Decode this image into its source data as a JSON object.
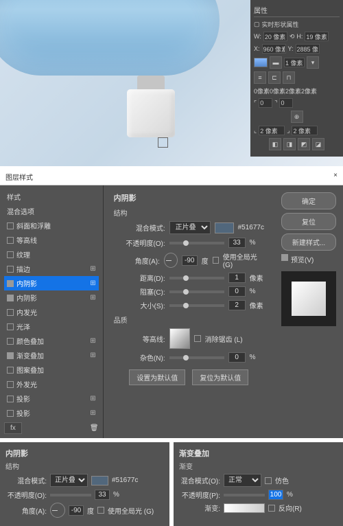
{
  "props": {
    "title": "属性",
    "subtitle": "实时形状属性",
    "w_label": "W:",
    "w": "20 像素",
    "h_label": "H:",
    "h": "19 像素",
    "x_label": "X:",
    "x": "960 像素",
    "y_label": "Y:",
    "y": "2885 像素",
    "stroke_label": "1 像素",
    "corners": "0像素0像素2像素2像素",
    "c1": "2 像素",
    "c2": "2 像素",
    "c3": "0"
  },
  "dialog": {
    "title": "图层样式",
    "close": "×",
    "left": {
      "styles": "样式",
      "blend": "混合选项",
      "items": [
        {
          "label": "斜面和浮雕",
          "checked": false,
          "plus": false
        },
        {
          "label": "等高线",
          "checked": false,
          "plus": false
        },
        {
          "label": "纹理",
          "checked": false,
          "plus": false
        },
        {
          "label": "描边",
          "checked": false,
          "plus": true
        },
        {
          "label": "内阴影",
          "checked": true,
          "plus": true,
          "active": true
        },
        {
          "label": "内阴影",
          "checked": true,
          "plus": true
        },
        {
          "label": "内发光",
          "checked": false,
          "plus": false
        },
        {
          "label": "光泽",
          "checked": false,
          "plus": false
        },
        {
          "label": "颜色叠加",
          "checked": false,
          "plus": true
        },
        {
          "label": "渐变叠加",
          "checked": true,
          "plus": true
        },
        {
          "label": "图案叠加",
          "checked": false,
          "plus": false
        },
        {
          "label": "外发光",
          "checked": false,
          "plus": false
        },
        {
          "label": "投影",
          "checked": false,
          "plus": true
        },
        {
          "label": "投影",
          "checked": false,
          "plus": true
        }
      ],
      "fx": "fx"
    },
    "center": {
      "heading": "内阴影",
      "struct": "结构",
      "blend_label": "混合模式:",
      "blend_val": "正片叠底",
      "color": "#51677c",
      "opacity_label": "不透明度(O):",
      "opacity": "33",
      "pct": "%",
      "angle_label": "角度(A):",
      "angle": "-90",
      "deg": "度",
      "global": "使用全局光 (G)",
      "distance_label": "距离(D):",
      "distance": "1",
      "px": "像素",
      "choke_label": "阻塞(C):",
      "choke": "0",
      "size_label": "大小(S):",
      "size": "2",
      "quality": "品质",
      "contour_label": "等高线:",
      "antialias": "消除锯齿 (L)",
      "noise_label": "杂色(N):",
      "noise": "0",
      "default1": "设置为默认值",
      "default2": "复位为默认值"
    },
    "right": {
      "ok": "确定",
      "cancel": "复位",
      "new": "新建样式...",
      "preview": "预览(V)"
    }
  },
  "bottom": {
    "p1": {
      "heading": "内阴影",
      "struct": "结构",
      "blend_label": "混合模式:",
      "blend_val": "正片叠底",
      "color": "#51677c",
      "opacity_label": "不透明度(O):",
      "opacity": "33",
      "pct": "%",
      "angle_label": "角度(A):",
      "angle": "-90",
      "deg": "度",
      "global": "使用全局光 (G)"
    },
    "p2": {
      "heading": "渐变叠加",
      "grad": "渐变",
      "blend_label": "混合模式(O):",
      "blend_val": "正常",
      "dither": "仿色",
      "opacity_label": "不透明度(P):",
      "opacity": "100",
      "pct": "%",
      "grad_label": "渐变:",
      "reverse": "反向(R)"
    }
  }
}
